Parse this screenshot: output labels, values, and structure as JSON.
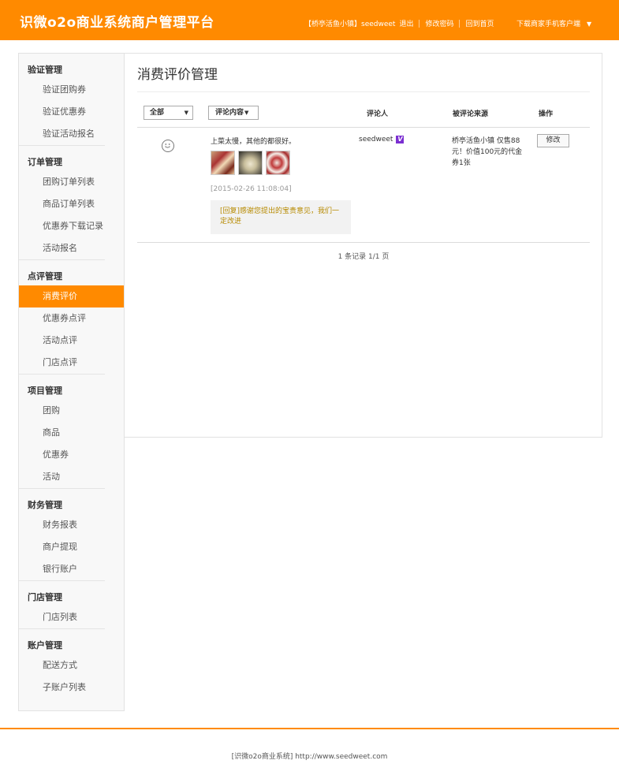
{
  "header": {
    "brand": "识微o2o商业系统商户管理平台",
    "shop": "【桥亭活鱼小镇】seedweet",
    "logout": "退出",
    "change_password": "修改密码",
    "home": "回到首页",
    "download": "下载商家手机客户端",
    "bg_color": "#ff8a00"
  },
  "sidebar": {
    "groups": [
      {
        "title": "验证管理",
        "items": [
          "验证团购券",
          "验证优惠券",
          "验证活动报名"
        ]
      },
      {
        "title": "订单管理",
        "items": [
          "团购订单列表",
          "商品订单列表",
          "优惠券下载记录",
          "活动报名"
        ]
      },
      {
        "title": "点评管理",
        "items": [
          "消费评价",
          "优惠券点评",
          "活动点评",
          "门店点评"
        ]
      },
      {
        "title": "项目管理",
        "items": [
          "团购",
          "商品",
          "优惠券",
          "活动"
        ]
      },
      {
        "title": "财务管理",
        "items": [
          "财务报表",
          "商户提现",
          "银行账户"
        ]
      },
      {
        "title": "门店管理",
        "items": [
          "门店列表"
        ]
      },
      {
        "title": "账户管理",
        "items": [
          "配送方式",
          "子账户列表"
        ]
      }
    ],
    "active_item": "消费评价"
  },
  "main": {
    "title": "消费评价管理",
    "filter_all": "全部",
    "filter_content": "评论内容",
    "col_reviewer": "评论人",
    "col_source": "被评论来源",
    "col_action": "操作",
    "rows": [
      {
        "mood_icon": "smile-icon",
        "comment": "上菜太慢，其他的都很好。",
        "time": "[2015-02-26 11:08:04]",
        "reply": "[回复]感谢您提出的宝贵意见，我们一定改进",
        "reviewer": "seedweet",
        "badge": "V",
        "source": "桥亭活鱼小镇 仅售88元！价值100元的代金券1张",
        "action": "修改"
      }
    ],
    "pager": "1 条记录 1/1 页"
  },
  "footer": {
    "text": "[识微o2o商业系统] http://www.seedweet.com"
  }
}
